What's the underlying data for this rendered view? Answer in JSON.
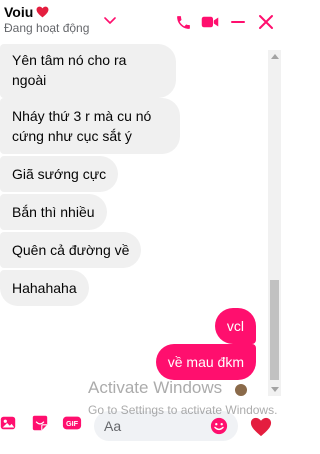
{
  "header": {
    "contact_name": "Voiu",
    "status": "Đang hoạt động"
  },
  "messages": [
    {
      "direction": "in",
      "lines": [
        "Yên tâm nó cho ra",
        "ngoài"
      ]
    },
    {
      "direction": "in",
      "lines": [
        "Nháy thứ 3 r mà cu nó",
        "cứng như cục sắt ý"
      ]
    },
    {
      "direction": "in",
      "lines": [
        "Giã sướng cực"
      ]
    },
    {
      "direction": "in",
      "lines": [
        "Bắn thì nhiều"
      ]
    },
    {
      "direction": "in",
      "lines": [
        "Quên cả đường về"
      ]
    },
    {
      "direction": "in",
      "lines": [
        "Hahahaha"
      ]
    },
    {
      "direction": "out",
      "lines": [
        "vcl"
      ]
    },
    {
      "direction": "out",
      "lines": [
        "về mau đkm"
      ]
    }
  ],
  "composer": {
    "placeholder": "Aa"
  },
  "watermark": {
    "title": "Activate Windows",
    "subtitle": "Go to Settings to activate Windows."
  },
  "colors": {
    "accent": "#ff0f6e",
    "incoming_bubble": "#f0f0f0",
    "heart": "#e41e3f"
  },
  "icons": {
    "header": [
      "heart-icon",
      "chevron-down-icon",
      "phone-icon",
      "video-icon",
      "minimize-icon",
      "close-icon"
    ],
    "composer": [
      "image-icon",
      "sticker-icon",
      "gif-icon",
      "emoji-icon",
      "like-heart-icon"
    ]
  }
}
